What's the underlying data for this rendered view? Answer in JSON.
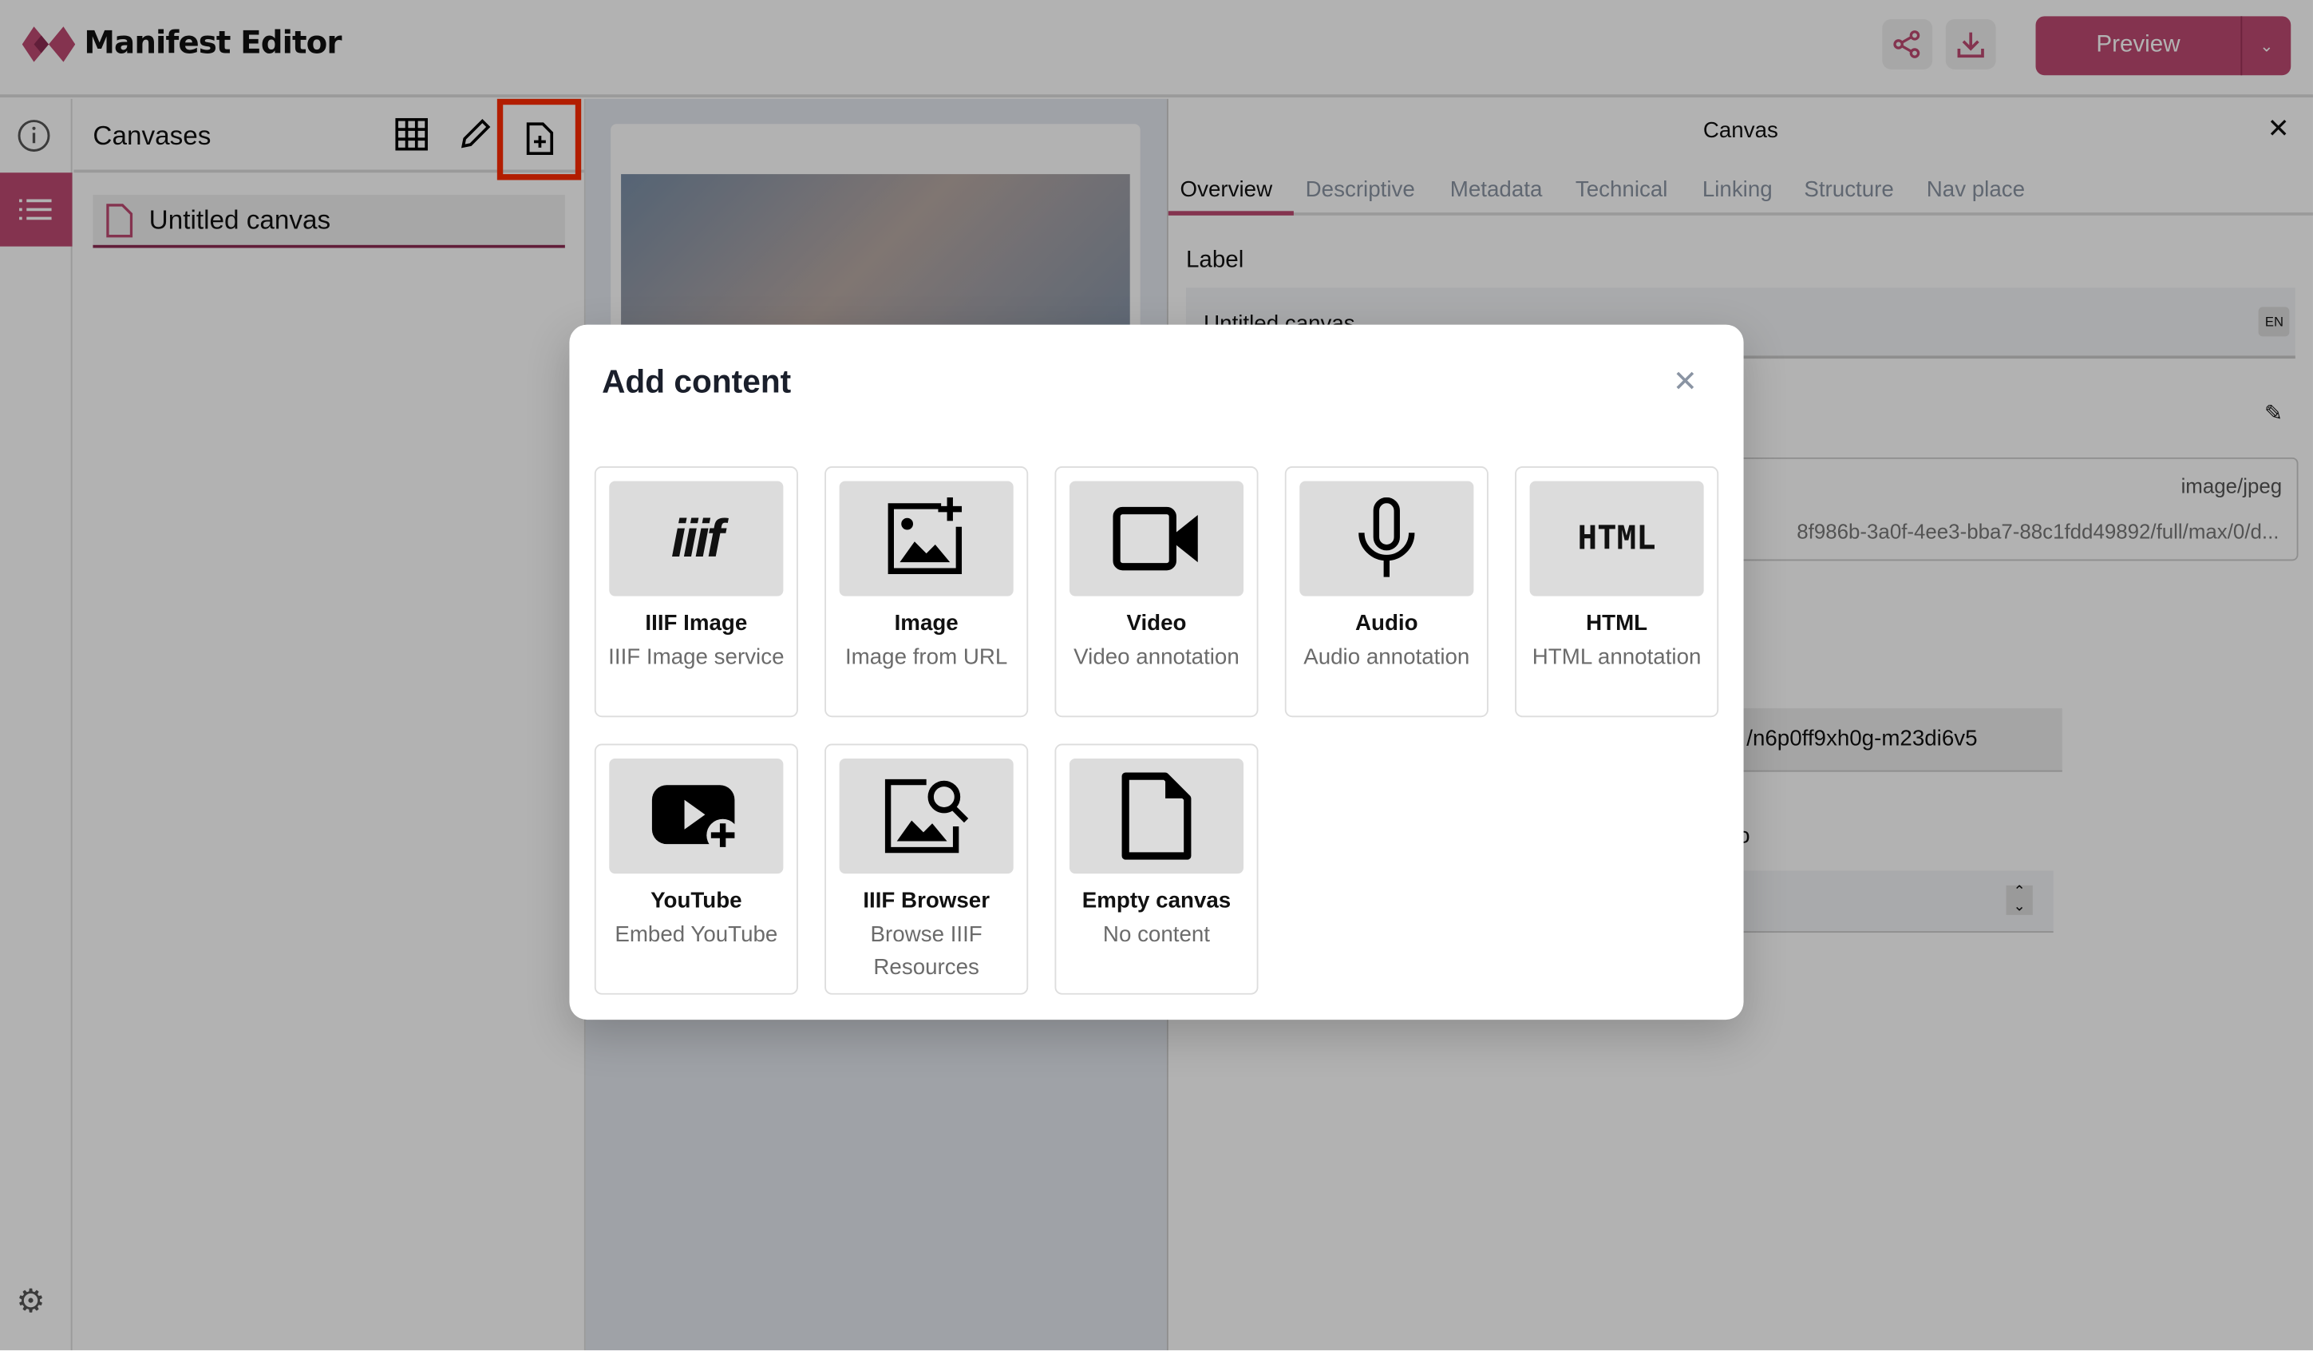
{
  "app": {
    "title": "Manifest Editor",
    "brand_color": "#be4a71"
  },
  "header": {
    "share_icon": "share-icon",
    "download_icon": "download-icon",
    "preview_label": "Preview"
  },
  "rail": {
    "items": [
      "info-icon",
      "list-icon"
    ],
    "settings_icon": "gear-icon"
  },
  "canvases": {
    "title": "Canvases",
    "items": [
      {
        "label": "Untitled canvas"
      }
    ]
  },
  "right_panel": {
    "title": "Canvas",
    "tabs": [
      "Overview",
      "Descriptive",
      "Metadata",
      "Technical",
      "Linking",
      "Structure",
      "Nav place"
    ],
    "active_tab": "Overview",
    "label_heading": "Label",
    "label_value": "Untitled canvas",
    "language": "EN",
    "media_type": "image/jpeg",
    "media_url": "8f986b-3a0f-4ee3-bba7-88c1fdd49892/full/max/0/d...",
    "id_value": "/n6p0ff9xh0g-m23di6v5",
    "partial_text": "o"
  },
  "modal": {
    "title": "Add content",
    "options": [
      {
        "title": "IIIF Image",
        "subtitle": "IIIF Image service",
        "icon": "iiif-icon"
      },
      {
        "title": "Image",
        "subtitle": "Image from URL",
        "icon": "image-add-icon"
      },
      {
        "title": "Video",
        "subtitle": "Video annotation",
        "icon": "video-icon"
      },
      {
        "title": "Audio",
        "subtitle": "Audio annotation",
        "icon": "microphone-icon"
      },
      {
        "title": "HTML",
        "subtitle": "HTML annotation",
        "icon": "html-icon"
      },
      {
        "title": "YouTube",
        "subtitle": "Embed YouTube",
        "icon": "youtube-icon"
      },
      {
        "title": "IIIF Browser",
        "subtitle": "Browse IIIF Resources",
        "icon": "image-search-icon"
      },
      {
        "title": "Empty canvas",
        "subtitle": "No content",
        "icon": "file-icon"
      }
    ],
    "html_glyph": "HTML",
    "iiif_glyph": "iiif"
  }
}
